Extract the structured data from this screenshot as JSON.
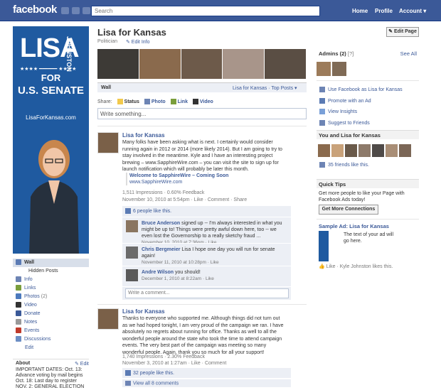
{
  "topbar": {
    "logo": "facebook",
    "search_placeholder": "Search",
    "nav": [
      "Home",
      "Profile",
      "Account ▾"
    ]
  },
  "profile": {
    "pic": {
      "name_big": "LISA",
      "name_vertical": "JOHNSTON",
      "for": "FOR",
      "senate": "U.S. SENATE",
      "url": "LisaForKansas.com"
    }
  },
  "leftnav": {
    "items": [
      {
        "label": "Wall",
        "color": "#5b7bb4",
        "selected": true
      },
      {
        "label": "Hidden Posts",
        "color": null
      },
      {
        "label": "Info",
        "color": "#6d84b4"
      },
      {
        "label": "Links",
        "color": "#7a9e3c"
      },
      {
        "label": "Photos",
        "count": "(2)",
        "color": "#4c7abd"
      },
      {
        "label": "Video",
        "color": "#333333"
      },
      {
        "label": "Donate",
        "color": "#3b5998"
      },
      {
        "label": "Notes",
        "color": "#999999"
      },
      {
        "label": "Events",
        "color": "#c03a2b"
      },
      {
        "label": "Discussions",
        "color": "#6c8ec4"
      }
    ],
    "edit": "Edit",
    "about_title": "About",
    "about_edit": "✎ Edit",
    "about_text_1": "IMPORTANT DATES: Oct. 13:",
    "about_text_2": "Advance voting by mail begins",
    "about_text_3": "Oct. 18: Last day to register",
    "about_text_4": "NOV. 2: GENERAL ELECTION"
  },
  "page": {
    "title": "Lisa for Kansas",
    "category": "Politician",
    "edit_info": "✎ Edit Info",
    "edit_page": "✎ Edit Page"
  },
  "wall": {
    "label": "Wall",
    "filter": "Lisa for Kansas · Top Posts ▾",
    "share_label": "Share:",
    "share_items": [
      "Status",
      "Photo",
      "Link",
      "Video"
    ],
    "composer_placeholder": "Write something..."
  },
  "posts": [
    {
      "author": "Lisa for Kansas",
      "text_lines": [
        "Many folks have been asking what is next. I certainly would consider",
        "running again in 2012 or 2014 (more likely 2014). But I am going to try to",
        "stay involved in the meantime. Kyle and I have an interesting project",
        "brewing – www.SapphireWire.com – you can visit the site to sign up for",
        "launch notification which will probably be later this month."
      ],
      "link_title": "Welcome to SapphireWire – Coming Soon",
      "link_url": "www.SapphireWire.com",
      "impressions": "1,511 Impressions · 0.60% Feedback",
      "time": "November 10, 2010 at 5:54pm · Like · Comment · Share",
      "likes": "6 people like this.",
      "comments": [
        {
          "author": "Bruce Anderson",
          "text": "signed up -- I'm always interested in what you might be up to! Things were pretty awful down here, too -- we even lost the Governorship to a really sketchy fraud ...",
          "time": "November 10, 2010 at 7:36pm · Like"
        },
        {
          "author": "Chris Bergmeier",
          "text": "Lisa I hope one day you will run for senate again!",
          "time": "November 11, 2010 at 10:28pm · Like"
        },
        {
          "author": "Andre Wilson",
          "text": "you should!",
          "time": "December 1, 2010 at 8:22am · Like"
        }
      ],
      "comment_placeholder": "Write a comment..."
    },
    {
      "author": "Lisa for Kansas",
      "text_lines": [
        "Thanks to everyone who supported me. Although things did not turn out",
        "as we had hoped tonight, I am very proud of the campaign we ran. I have",
        "absolutely no regrets about running for office. Thanks as well to all the",
        "wonderful people around the state who took the time to attend campaign",
        "events. The very best part of the campaign was meeting so many",
        "wonderful people. Again, thank you so much for all your support!"
      ],
      "impressions": "1,740 Impressions · 2.30% Feedback",
      "time": "November 3, 2010 at 1:27am · Like · Comment",
      "likes": "32 people like this.",
      "view_comments": "View all 8 comments"
    }
  ],
  "right": {
    "admins_title": "Admins (2)",
    "admins_help": "[?]",
    "see_all": "See All",
    "actions": [
      {
        "label": "Use Facebook as Lisa for Kansas",
        "icon": "swap-icon",
        "color": "#6d84b4"
      },
      {
        "label": "Promote with an Ad",
        "icon": "megaphone-icon",
        "color": "#5b7bb4"
      },
      {
        "label": "View Insights",
        "icon": "chart-icon",
        "color": "#7aa0d8"
      },
      {
        "label": "Suggest to Friends",
        "icon": "people-icon",
        "color": "#6d84b4"
      }
    ],
    "friends_title": "You and Lisa for Kansas",
    "friends_count": "35 friends like this.",
    "tips_title": "Quick Tips",
    "tips_text_1": "Get more people to like your Page with",
    "tips_text_2": "Facebook Ads today!",
    "tips_button": "Get More Connections",
    "ad_title": "Sample Ad: Lisa for Kansas",
    "ad_text_1": "The text of your ad will",
    "ad_text_2": "go here.",
    "ad_like": "👍 Like · Kyle Johnston likes this."
  }
}
